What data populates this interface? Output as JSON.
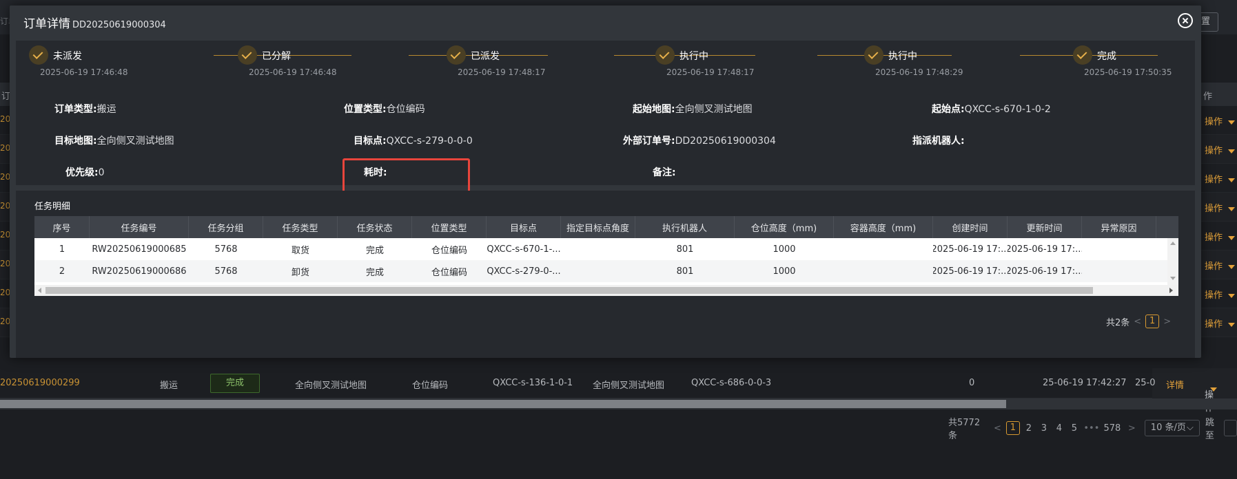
{
  "background": {
    "reset_label": "置",
    "left_fragment": "订单",
    "header_left": "订",
    "header_right": "作",
    "row_id_prefixes": [
      "202",
      "202",
      "202",
      "202",
      "202",
      "202",
      "202",
      "202"
    ],
    "row_action_label": "操作",
    "last_row": {
      "order_id": "20250619000299",
      "type": "搬运",
      "status": "完成",
      "start_map": "全向侧叉测试地图",
      "location_type": "仓位编码",
      "start_point": "QXCC-s-136-1-0-1",
      "target_map": "全向侧叉测试地图",
      "target_point": "QXCC-s-686-0-0-3",
      "priority": "0",
      "created": "25-06-19 17:42:27",
      "updated": "25-0",
      "detail_label": "详情",
      "action_label": "操作"
    },
    "pagination": {
      "total": "共5772条",
      "prev": "<",
      "pages": [
        "1",
        "2",
        "3",
        "4",
        "5"
      ],
      "dots": "•••",
      "last": "578",
      "next": ">",
      "page_size": "10 条/页",
      "page_size_arrow": "⌵",
      "jump_label": "跳至"
    }
  },
  "modal": {
    "title": "订单详情",
    "order_no": "DD20250619000304",
    "steps": [
      {
        "name": "未派发",
        "time": "2025-06-19 17:46:48"
      },
      {
        "name": "已分解",
        "time": "2025-06-19 17:46:48"
      },
      {
        "name": "已派发",
        "time": "2025-06-19 17:48:17"
      },
      {
        "name": "执行中",
        "time": "2025-06-19 17:48:17"
      },
      {
        "name": "执行中",
        "time": "2025-06-19 17:48:29"
      },
      {
        "name": "完成",
        "time": "2025-06-19 17:50:35"
      }
    ],
    "info": {
      "order_type_label": "订单类型:",
      "order_type": "搬运",
      "location_type_label": "位置类型:",
      "location_type": "仓位编码",
      "start_map_label": "起始地图:",
      "start_map": "全向侧叉测试地图",
      "start_point_label": "起始点:",
      "start_point": "QXCC-s-670-1-0-2",
      "target_map_label": "目标地图:",
      "target_map": "全向侧叉测试地图",
      "target_point_label": "目标点:",
      "target_point": "QXCC-s-279-0-0-0",
      "external_no_label": "外部订单号:",
      "external_no": "DD20250619000304",
      "robot_label": "指派机器人:",
      "robot": "",
      "priority_label": "优先级:",
      "priority": "0",
      "duration_label": "耗时:",
      "duration": "",
      "remark_label": "备注:",
      "remark": ""
    },
    "task_detail": {
      "title": "任务明细",
      "columns": [
        "序号",
        "任务编号",
        "任务分组",
        "任务类型",
        "任务状态",
        "位置类型",
        "目标点",
        "指定目标点角度",
        "执行机器人",
        "仓位高度（mm)",
        "容器高度（mm)",
        "创建时间",
        "更新时间",
        "异常原因"
      ],
      "rows": [
        [
          "1",
          "RW20250619000685",
          "5768",
          "取货",
          "完成",
          "仓位编码",
          "QXCC-s-670-1-...",
          "",
          "801",
          "1000",
          "",
          "2025-06-19 17:...",
          "2025-06-19 17:...",
          ""
        ],
        [
          "2",
          "RW20250619000686",
          "5768",
          "卸货",
          "完成",
          "仓位编码",
          "QXCC-s-279-0-...",
          "",
          "801",
          "1000",
          "",
          "2025-06-19 17:...",
          "2025-06-19 17:...",
          ""
        ]
      ],
      "pagination": {
        "total": "共2条",
        "prev": "<",
        "page": "1",
        "next": ">"
      }
    }
  },
  "colors": {
    "accent": "#d99a31",
    "highlight_box": "#e8453c",
    "modal_bg": "#32363b",
    "panel_bg": "#26292e"
  }
}
